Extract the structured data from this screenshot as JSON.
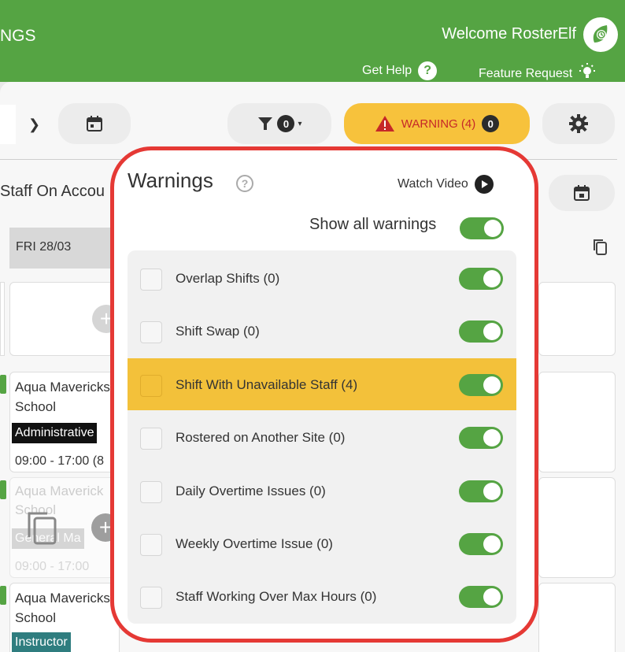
{
  "header": {
    "title": "NGS",
    "welcome": "Welcome RosterElf",
    "help_label": "Get Help",
    "feature_label": "Feature Request"
  },
  "toolbar": {
    "filter_count": "0",
    "warning_label": "WARNING (4)",
    "warning_badge": "0"
  },
  "background": {
    "staff_on_account": "Staff On Accou",
    "day_header": "FRI 28/03",
    "cards": [
      {
        "name": "Aqua Mavericks",
        "sub": "School",
        "tag": "Administrative",
        "time": "09:00 - 17:00 (8"
      },
      {
        "name": "Aqua Maverick",
        "sub": "School",
        "tag": "General Ma",
        "time": "09:00 - 17:00"
      },
      {
        "name": "Aqua Mavericks",
        "sub": "School",
        "tag": "Instructor"
      }
    ]
  },
  "popup": {
    "title": "Warnings",
    "watch_video": "Watch Video",
    "show_all": "Show all warnings",
    "show_all_enabled": true,
    "items": [
      {
        "label": "Overlap Shifts (0)",
        "enabled": true
      },
      {
        "label": "Shift Swap (0)",
        "enabled": true
      },
      {
        "label": "Shift With Unavailable Staff (4)",
        "enabled": true,
        "highlighted": true
      },
      {
        "label": "Rostered on Another Site (0)",
        "enabled": true
      },
      {
        "label": "Daily Overtime Issues (0)",
        "enabled": true
      },
      {
        "label": "Weekly Overtime Issue (0)",
        "enabled": true
      },
      {
        "label": "Staff Working Over Max Hours (0)",
        "enabled": true
      }
    ]
  },
  "colors": {
    "brand_green": "#55a443",
    "warning_yellow": "#f7c23c",
    "warning_red": "#c62828",
    "annotation_red": "#e53935",
    "administrative_tag": "#111111",
    "instructor_tag": "#2f7d7f"
  }
}
